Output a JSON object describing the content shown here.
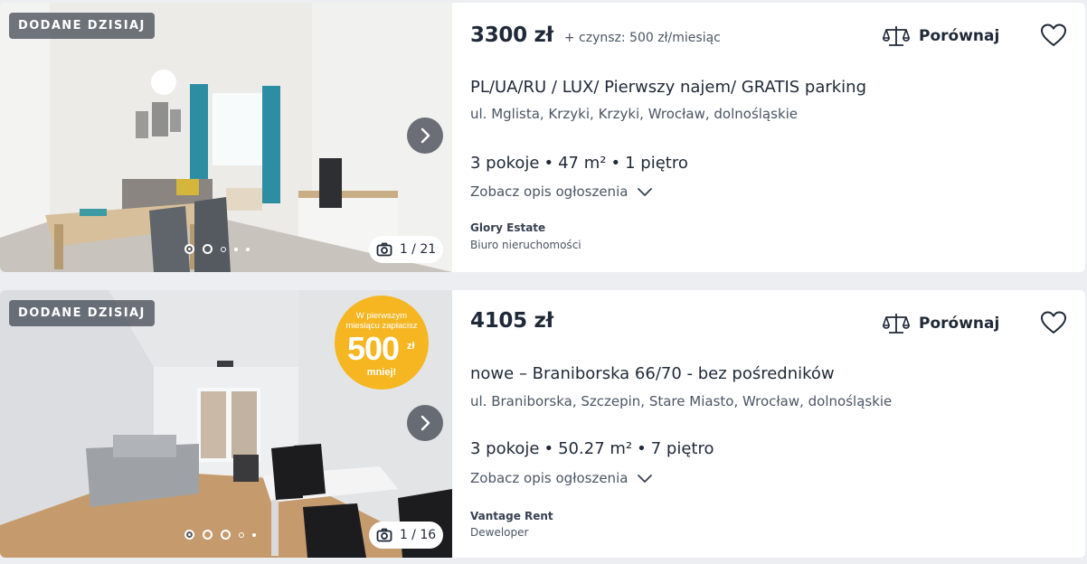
{
  "listings": [
    {
      "badge": "DODANE DZISIAJ",
      "price": "3300 zł",
      "rent": "+ czynsz: 500 zł/miesiąc",
      "compare_label": "Porównaj",
      "title": "PL/UA/RU / LUX/ Pierwszy najem/ GRATIS parking",
      "address": "ul. Mglista, Krzyki, Krzyki, Wrocław, dolnośląskie",
      "rooms": "3 pokoje",
      "area": "47 m²",
      "floor": "1 piętro",
      "desc_link": "Zobacz opis ogłoszenia",
      "agency": "Glory Estate",
      "agency_type": "Biuro nieruchomości",
      "photo_counter": "1 / 21"
    },
    {
      "badge": "DODANE DZISIAJ",
      "price": "4105 zł",
      "compare_label": "Porównaj",
      "title": "nowe – Braniborska 66/70 - bez pośredników",
      "address": "ul. Braniborska, Szczepin, Stare Miasto, Wrocław, dolnośląskie",
      "rooms": "3 pokoje",
      "area": "50.27 m²",
      "floor": "7 piętro",
      "desc_link": "Zobacz opis ogłoszenia",
      "agency": "Vantage Rent",
      "agency_type": "Deweloper",
      "photo_counter": "1 / 16",
      "promo": {
        "line1": "W pierwszym",
        "line2": "miesiącu zapłacisz",
        "amount": "500",
        "currency": "zł",
        "line3": "mniej!"
      }
    }
  ],
  "separator": "•",
  "icons": {
    "compare": "scale-icon",
    "favorite": "heart-icon",
    "next": "chevron-right-icon",
    "expand": "chevron-down-icon",
    "camera": "camera-icon"
  },
  "colors": {
    "promo_badge": "#f5b622",
    "page_bg": "#eceef1",
    "text": "#1f2937"
  }
}
